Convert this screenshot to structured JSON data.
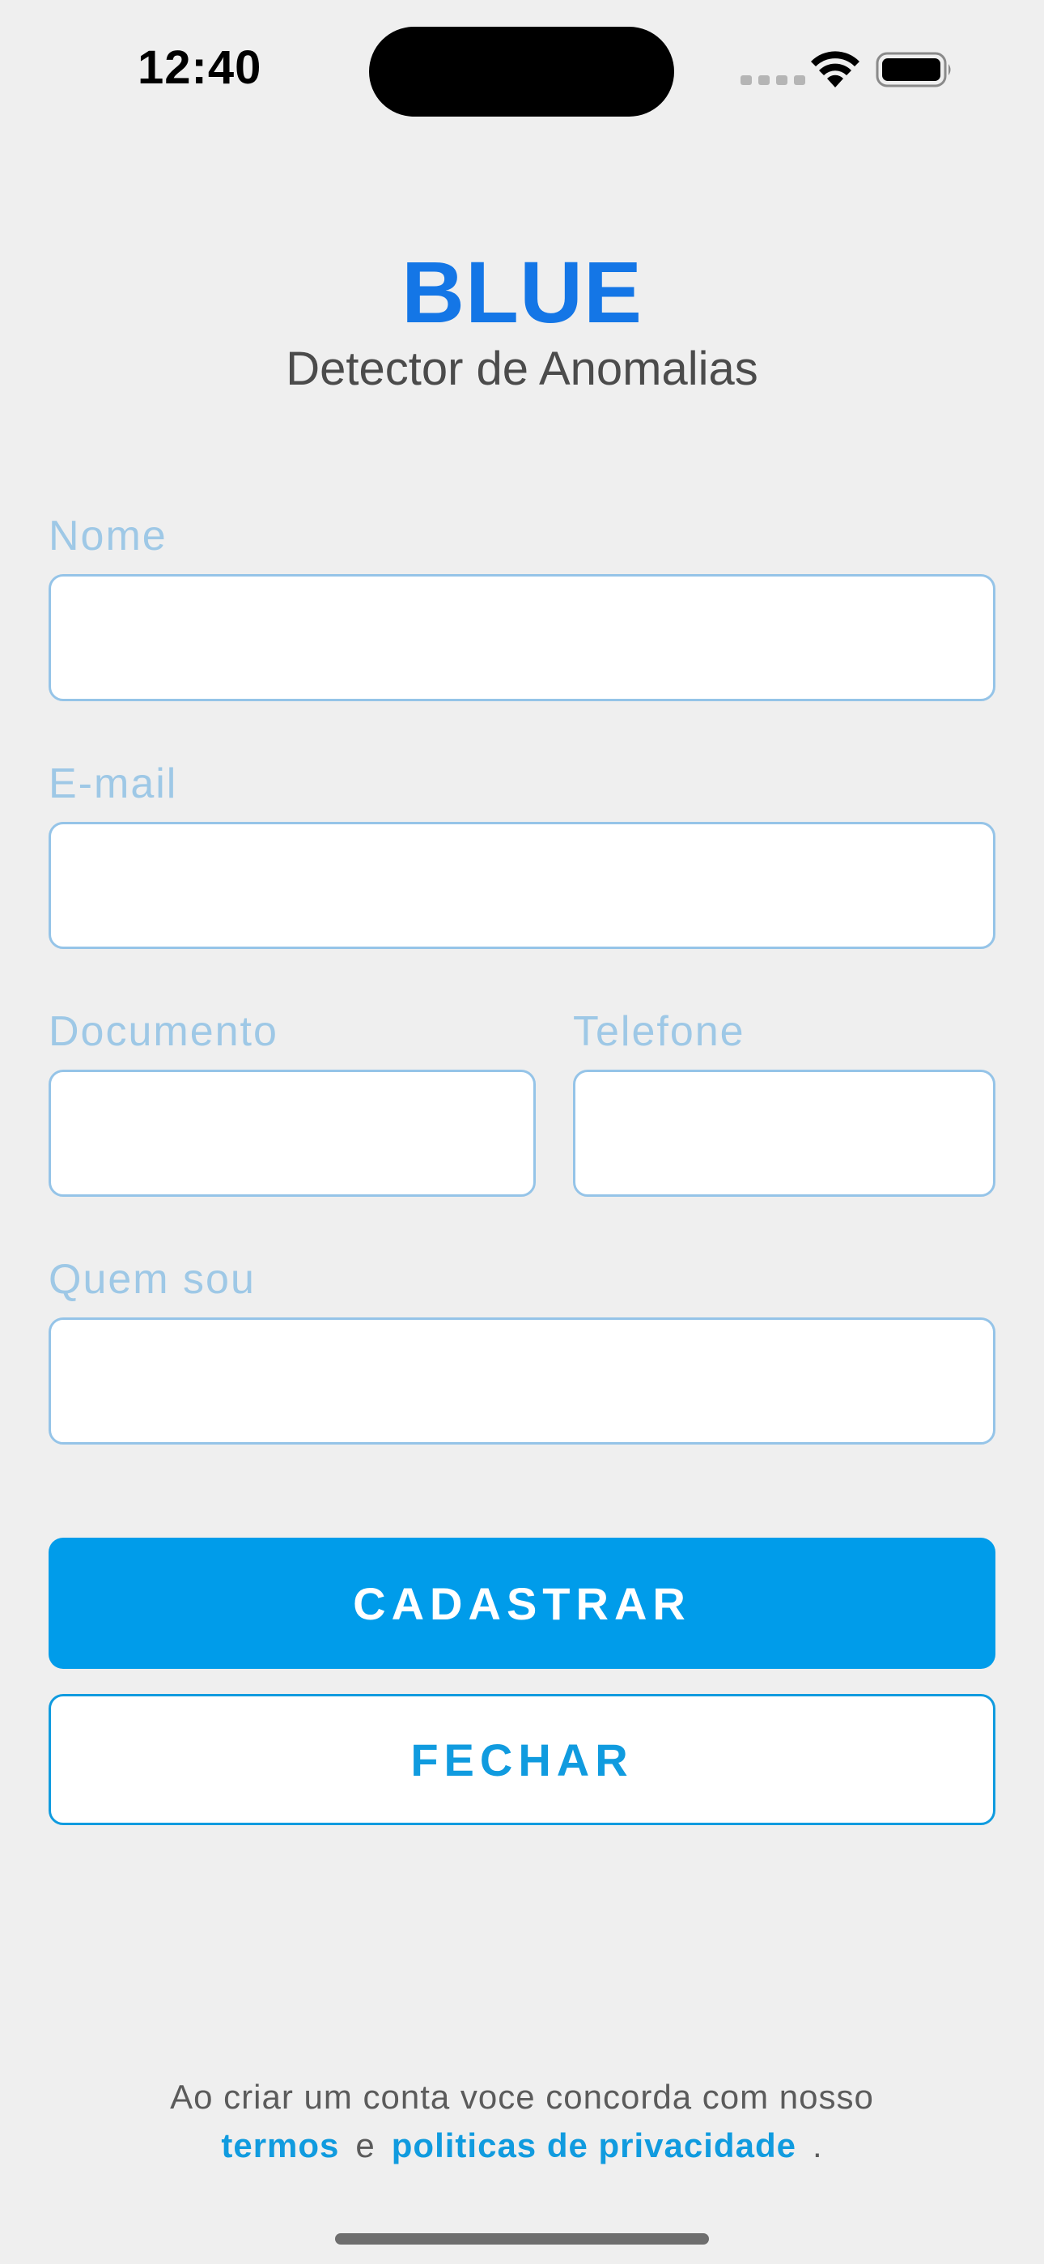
{
  "status_bar": {
    "time": "12:40",
    "icons": [
      "signal-dots-icon",
      "wifi-icon",
      "battery-icon"
    ]
  },
  "header": {
    "title": "BLUE",
    "subtitle": "Detector de Anomalias"
  },
  "form": {
    "nome": {
      "label": "Nome",
      "value": ""
    },
    "email": {
      "label": "E-mail",
      "value": ""
    },
    "documento": {
      "label": "Documento",
      "value": ""
    },
    "telefone": {
      "label": "Telefone",
      "value": ""
    },
    "quem_sou": {
      "label": "Quem sou",
      "value": ""
    }
  },
  "buttons": {
    "register": "CADASTRAR",
    "close": "FECHAR"
  },
  "footer": {
    "line1": "Ao criar um conta voce concorda com nosso",
    "terms_link": "termos",
    "connector": "e",
    "privacy_link": "politicas de privacidade",
    "end": "."
  },
  "colors": {
    "background": "#efefef",
    "brand_blue": "#1476e6",
    "primary_button": "#009cea",
    "label": "#9ec8e6",
    "input_border": "#95c4e8",
    "link": "#109bdf"
  }
}
